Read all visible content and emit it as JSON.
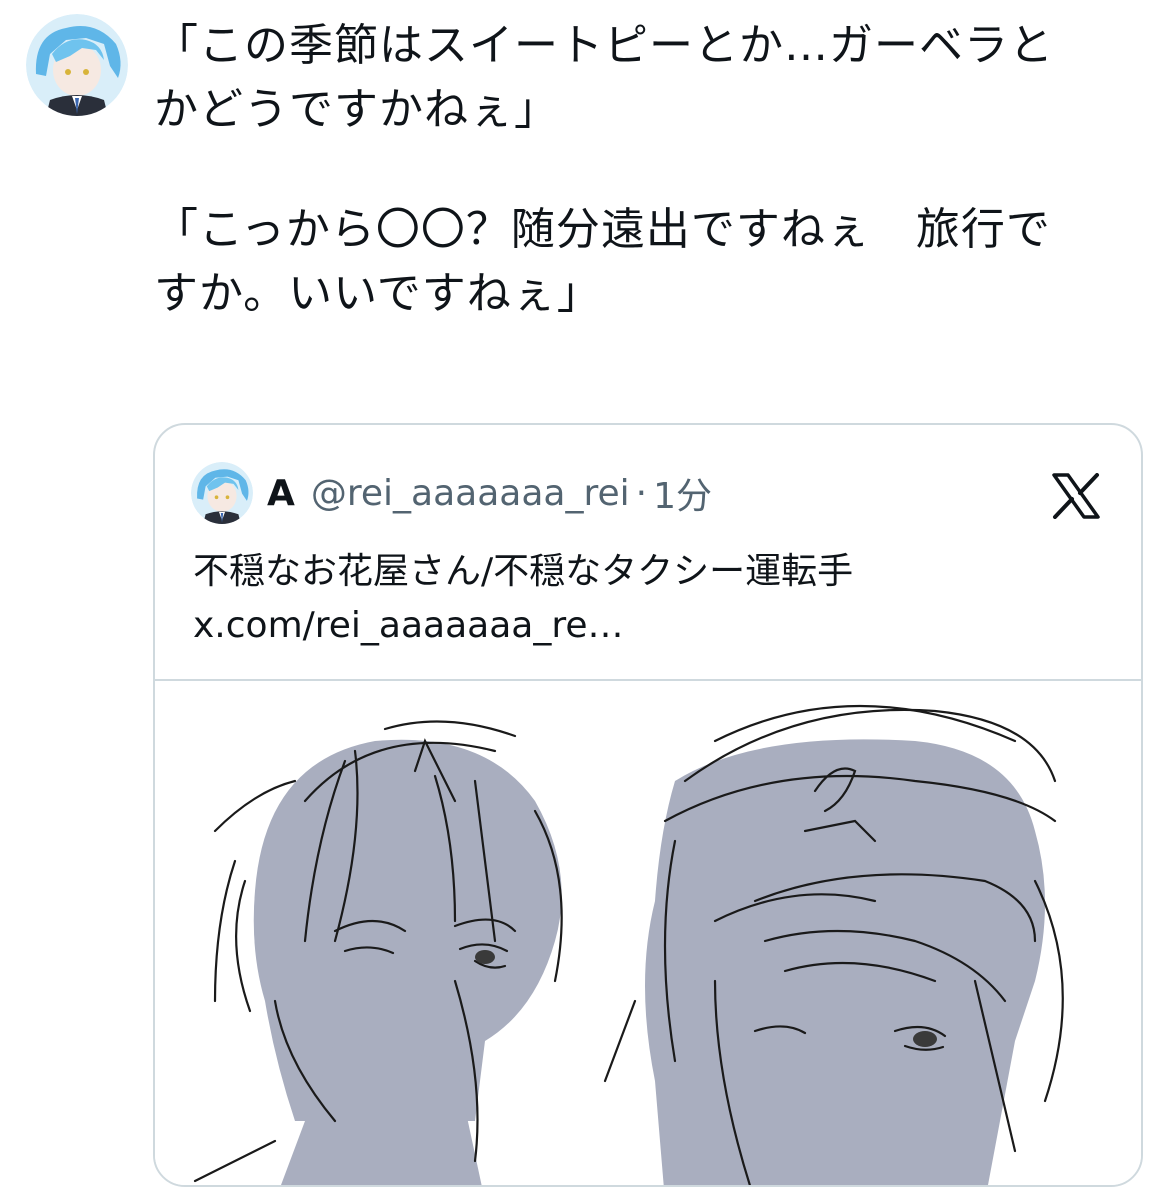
{
  "tweet": {
    "avatar_icon": "profile-avatar-blue-hair",
    "paragraphs": [
      [
        "「この季節はスイートピーとか…ガーベラと",
        "かどうですかねぇ」"
      ],
      [
        "「こっから〇〇？随分遠出ですねぇ　旅行で",
        "すか。いいですねぇ」"
      ]
    ]
  },
  "quote": {
    "name": "A",
    "handle": "@rei_aaaaaaa_rei",
    "separator": "·",
    "time": "1分",
    "platform_icon": "x-logo-icon",
    "text_line": "不穏なお花屋さん/不穏なタクシー運転手",
    "link_text": "x.com/rei_aaaaaaa_re…",
    "media_icon": "sketch-illustration-two-characters"
  },
  "colors": {
    "text": "#0f1419",
    "secondary": "#536471",
    "border": "#cfd9de",
    "sketch_fill": "#a9aebf",
    "avatar_hair": "#6fc3ee"
  }
}
